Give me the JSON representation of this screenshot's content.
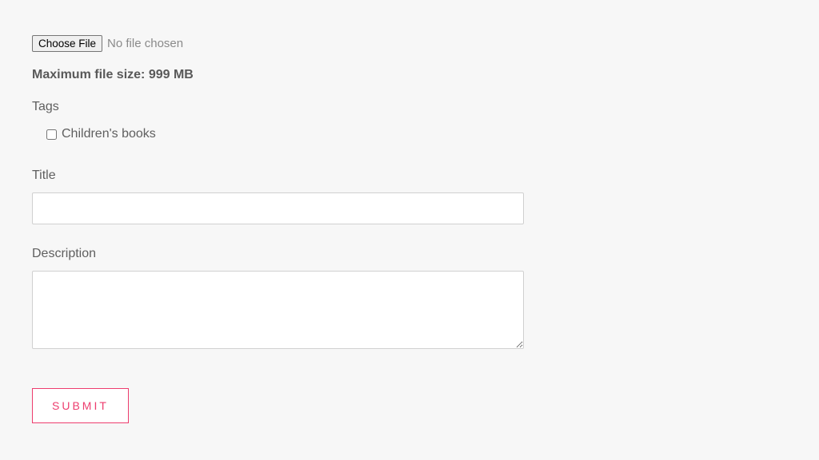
{
  "file": {
    "button_label": "Choose File",
    "status_text": "No file chosen",
    "max_size_text": "Maximum file size: 999 MB"
  },
  "tags": {
    "heading": "Tags",
    "items": [
      {
        "label": "Children's books",
        "checked": false
      }
    ]
  },
  "fields": {
    "title": {
      "label": "Title",
      "value": ""
    },
    "description": {
      "label": "Description",
      "value": ""
    }
  },
  "actions": {
    "submit_label": "SUBMIT"
  }
}
